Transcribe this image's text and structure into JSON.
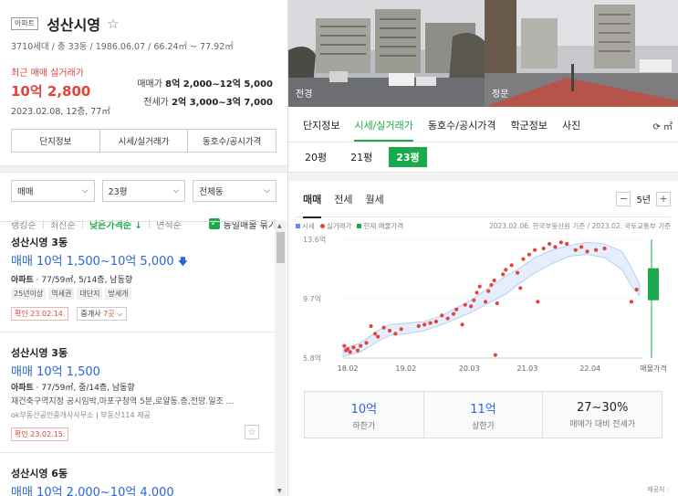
{
  "listing": {
    "type_badge": "아파트",
    "title": "성산시영",
    "star": "☆",
    "meta": "3710세대 / 총 33동 / 1986.06.07 / 66.24㎡ ~ 77.92㎡",
    "recent_label": "최근 매매 실거래가",
    "recent_price": "10억 2,800",
    "recent_date": "2023.02.08, 12층, 77㎡",
    "sale_label": "매매가",
    "sale_range": "8억 2,000~12억 5,000",
    "jeonse_label": "전세가",
    "jeonse_range": "2억 3,000~3억 7,000",
    "buttons": [
      "단지정보",
      "시세/실거래가",
      "동호수/공시가격"
    ]
  },
  "filters": {
    "deal": "매매",
    "size": "23평",
    "building": "전체동"
  },
  "sort": {
    "items": [
      "랭킹순",
      "최신순",
      "낮은가격순 ↓",
      "면적순"
    ],
    "active": 2,
    "same_label": "동일매물 묶기"
  },
  "items": [
    {
      "title": "성산시영 3동",
      "price": "매매 10억 1,500~10억 5,000",
      "info_type": "아파트",
      "info": " · 77/59㎡, 5/14층, 남동향",
      "tags": [
        "25년이상",
        "역세권",
        "대단지",
        "방세개"
      ],
      "confirm": "확인 23.02.14.",
      "agent": "중개사",
      "agent_count": "7곳"
    },
    {
      "title": "성산시영 3동",
      "price": "매매 10억 1,500",
      "info_type": "아파트",
      "info": " · 77/59㎡, 중/14층, 남동향",
      "desc": "재건축구역지정 공시임박,마포구청역 5분,로얄동.층,전망.일조 …",
      "source": "ok부동산공인중개사사무소 | 부동산114 제공",
      "confirm": "확인 23.02.15."
    },
    {
      "title": "성산시영 6동",
      "price": "매매 10억 2,000~10억 4,000"
    }
  ],
  "photos": [
    {
      "label": "전경"
    },
    {
      "label": "정문"
    }
  ],
  "tabs": {
    "items": [
      "단지정보",
      "시세/실거래가",
      "동호수/공시가격",
      "학군정보",
      "사진"
    ],
    "unit": "⟳ ㎡"
  },
  "sizes": [
    "20평",
    "21평",
    "23평"
  ],
  "deal_tabs": [
    "매매",
    "전세",
    "월세"
  ],
  "period": "5년",
  "legend": {
    "items": [
      {
        "label": "시세",
        "color": "#5b8ff0"
      },
      {
        "label": "실거래가",
        "color": "#e4433c"
      },
      {
        "label": "현재 매물가격",
        "color": "#1aaa4b"
      }
    ],
    "source": "2023.02.06. 한국부동산원 기준 / 2023.02. 국토교통부 기준"
  },
  "chart_data": {
    "type": "scatter",
    "y_ticks": [
      "13.6억",
      "9.7억",
      "5.8억"
    ],
    "x_ticks": [
      "18.02",
      "19.02",
      "20.03",
      "21.03",
      "22.04",
      "매물가격"
    ],
    "ylim": [
      5.8,
      13.6
    ],
    "market_band_upper": [
      [
        2018.0,
        6.4
      ],
      [
        2018.3,
        6.8
      ],
      [
        2018.6,
        7.6
      ],
      [
        2018.8,
        8.0
      ],
      [
        2019.1,
        8.1
      ],
      [
        2019.4,
        8.2
      ],
      [
        2019.7,
        8.6
      ],
      [
        2019.9,
        9.0
      ],
      [
        2020.2,
        9.6
      ],
      [
        2020.5,
        10.4
      ],
      [
        2020.8,
        11.2
      ],
      [
        2021.0,
        11.6
      ],
      [
        2021.3,
        12.4
      ],
      [
        2021.6,
        12.9
      ],
      [
        2021.9,
        13.2
      ],
      [
        2022.2,
        13.4
      ],
      [
        2022.5,
        13.3
      ],
      [
        2022.8,
        12.8
      ],
      [
        2022.95,
        11.8
      ],
      [
        2023.1,
        10.7
      ]
    ],
    "market_band_lower": [
      [
        2018.0,
        5.9
      ],
      [
        2018.3,
        6.2
      ],
      [
        2018.6,
        6.9
      ],
      [
        2018.8,
        7.3
      ],
      [
        2019.1,
        7.4
      ],
      [
        2019.4,
        7.6
      ],
      [
        2019.7,
        8.0
      ],
      [
        2019.9,
        8.3
      ],
      [
        2020.2,
        8.8
      ],
      [
        2020.5,
        9.4
      ],
      [
        2020.8,
        10.0
      ],
      [
        2021.0,
        10.6
      ],
      [
        2021.3,
        11.4
      ],
      [
        2021.6,
        12.0
      ],
      [
        2021.9,
        12.5
      ],
      [
        2022.2,
        12.6
      ],
      [
        2022.5,
        12.4
      ],
      [
        2022.8,
        11.6
      ],
      [
        2022.95,
        10.6
      ],
      [
        2023.1,
        9.9
      ]
    ],
    "transactions": [
      [
        2018.02,
        6.6
      ],
      [
        2018.05,
        6.3
      ],
      [
        2018.08,
        6.4
      ],
      [
        2018.12,
        6.2
      ],
      [
        2018.18,
        6.5
      ],
      [
        2018.25,
        6.3
      ],
      [
        2018.3,
        6.6
      ],
      [
        2018.4,
        6.8
      ],
      [
        2018.48,
        7.9
      ],
      [
        2018.55,
        7.4
      ],
      [
        2018.6,
        7.2
      ],
      [
        2018.7,
        7.8
      ],
      [
        2018.8,
        7.6
      ],
      [
        2018.9,
        7.4
      ],
      [
        2019.0,
        7.7
      ],
      [
        2019.3,
        7.9
      ],
      [
        2019.4,
        8.0
      ],
      [
        2019.5,
        8.1
      ],
      [
        2019.6,
        8.2
      ],
      [
        2019.7,
        8.6
      ],
      [
        2019.8,
        8.4
      ],
      [
        2019.9,
        8.7
      ],
      [
        2019.95,
        9.0
      ],
      [
        2020.05,
        8.0
      ],
      [
        2020.1,
        9.3
      ],
      [
        2020.2,
        9.2
      ],
      [
        2020.25,
        9.6
      ],
      [
        2020.3,
        10.1
      ],
      [
        2020.35,
        10.5
      ],
      [
        2020.45,
        9.5
      ],
      [
        2020.5,
        10.2
      ],
      [
        2020.55,
        10.6
      ],
      [
        2020.6,
        10.9
      ],
      [
        2020.62,
        6.0
      ],
      [
        2020.65,
        9.4
      ],
      [
        2020.75,
        11.3
      ],
      [
        2020.8,
        11.6
      ],
      [
        2020.9,
        11.9
      ],
      [
        2021.0,
        11.4
      ],
      [
        2021.05,
        10.4
      ],
      [
        2021.1,
        12.3
      ],
      [
        2021.2,
        12.6
      ],
      [
        2021.3,
        12.9
      ],
      [
        2021.35,
        9.5
      ],
      [
        2021.45,
        13.0
      ],
      [
        2021.55,
        13.3
      ],
      [
        2021.65,
        13.1
      ],
      [
        2021.75,
        13.4
      ],
      [
        2021.85,
        13.3
      ],
      [
        2022.0,
        12.9
      ],
      [
        2022.1,
        13.1
      ],
      [
        2022.2,
        12.8
      ],
      [
        2022.35,
        12.9
      ],
      [
        2022.5,
        13.0
      ],
      [
        2023.05,
        10.3
      ],
      [
        2022.96,
        9.5
      ]
    ],
    "listing_range": [
      9.6,
      11.7
    ]
  },
  "stats": [
    {
      "value": "10억",
      "label": "하한가"
    },
    {
      "value": "11억",
      "label": "상한가"
    },
    {
      "value": "27~30%",
      "label": "매매가 대비 전세가"
    }
  ],
  "provider": "제공처 :"
}
